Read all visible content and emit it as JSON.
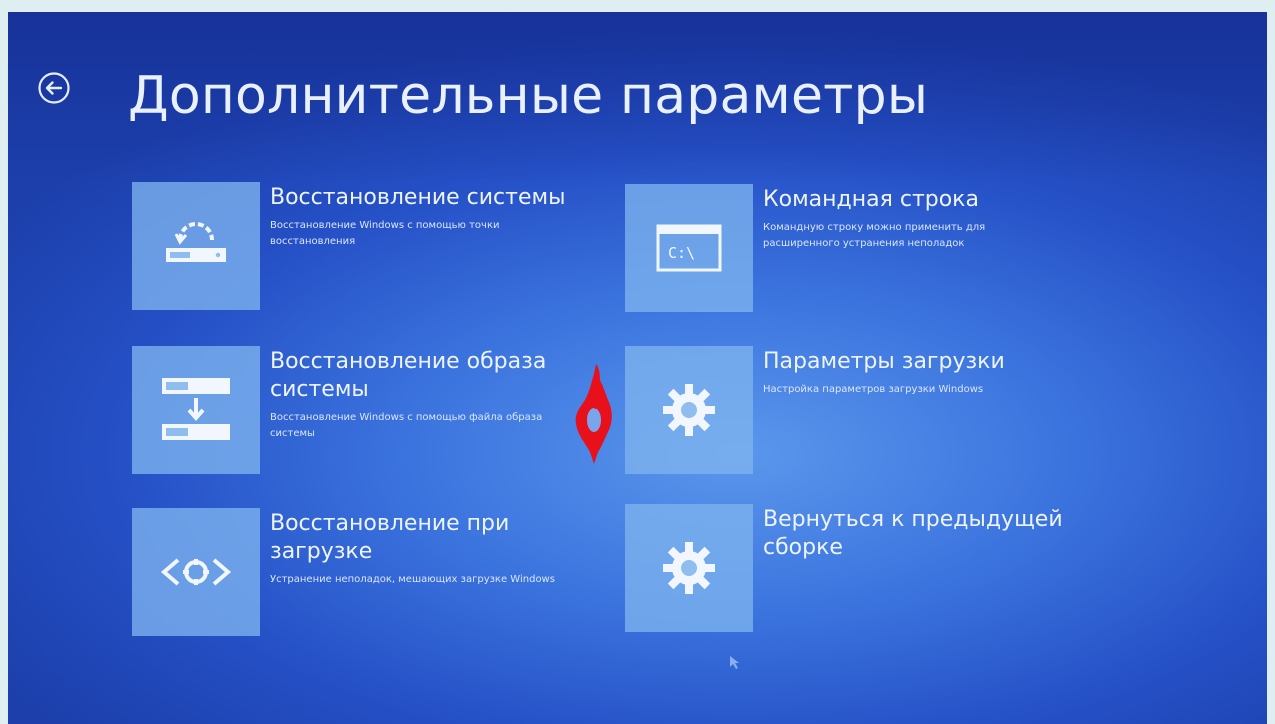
{
  "page": {
    "title": "Дополнительные параметры"
  },
  "options": [
    {
      "title": "Восстановление системы",
      "description": "Восстановление Windows с помощью точки восстановления",
      "icon": "restore-icon"
    },
    {
      "title": "Командная строка",
      "description": "Командную строку можно применить для расширенного устранения неполадок",
      "icon": "command-prompt-icon"
    },
    {
      "title": "Восстановление образа системы",
      "description": "Восстановление Windows с помощью файла образа системы",
      "icon": "system-image-icon"
    },
    {
      "title": "Параметры загрузки",
      "description": "Настройка параметров загрузки Windows",
      "icon": "gear-icon"
    },
    {
      "title": "Восстановление при загрузке",
      "description": "Устранение неполадок, мешающих загрузке Windows",
      "icon": "startup-repair-icon"
    },
    {
      "title": "Вернуться к предыдущей сборке",
      "description": "",
      "icon": "gear-icon"
    }
  ],
  "colors": {
    "background": "#3b73de",
    "tile": "#7eb4ee",
    "text": "#eef4ff",
    "annotation": "#e8101a"
  }
}
